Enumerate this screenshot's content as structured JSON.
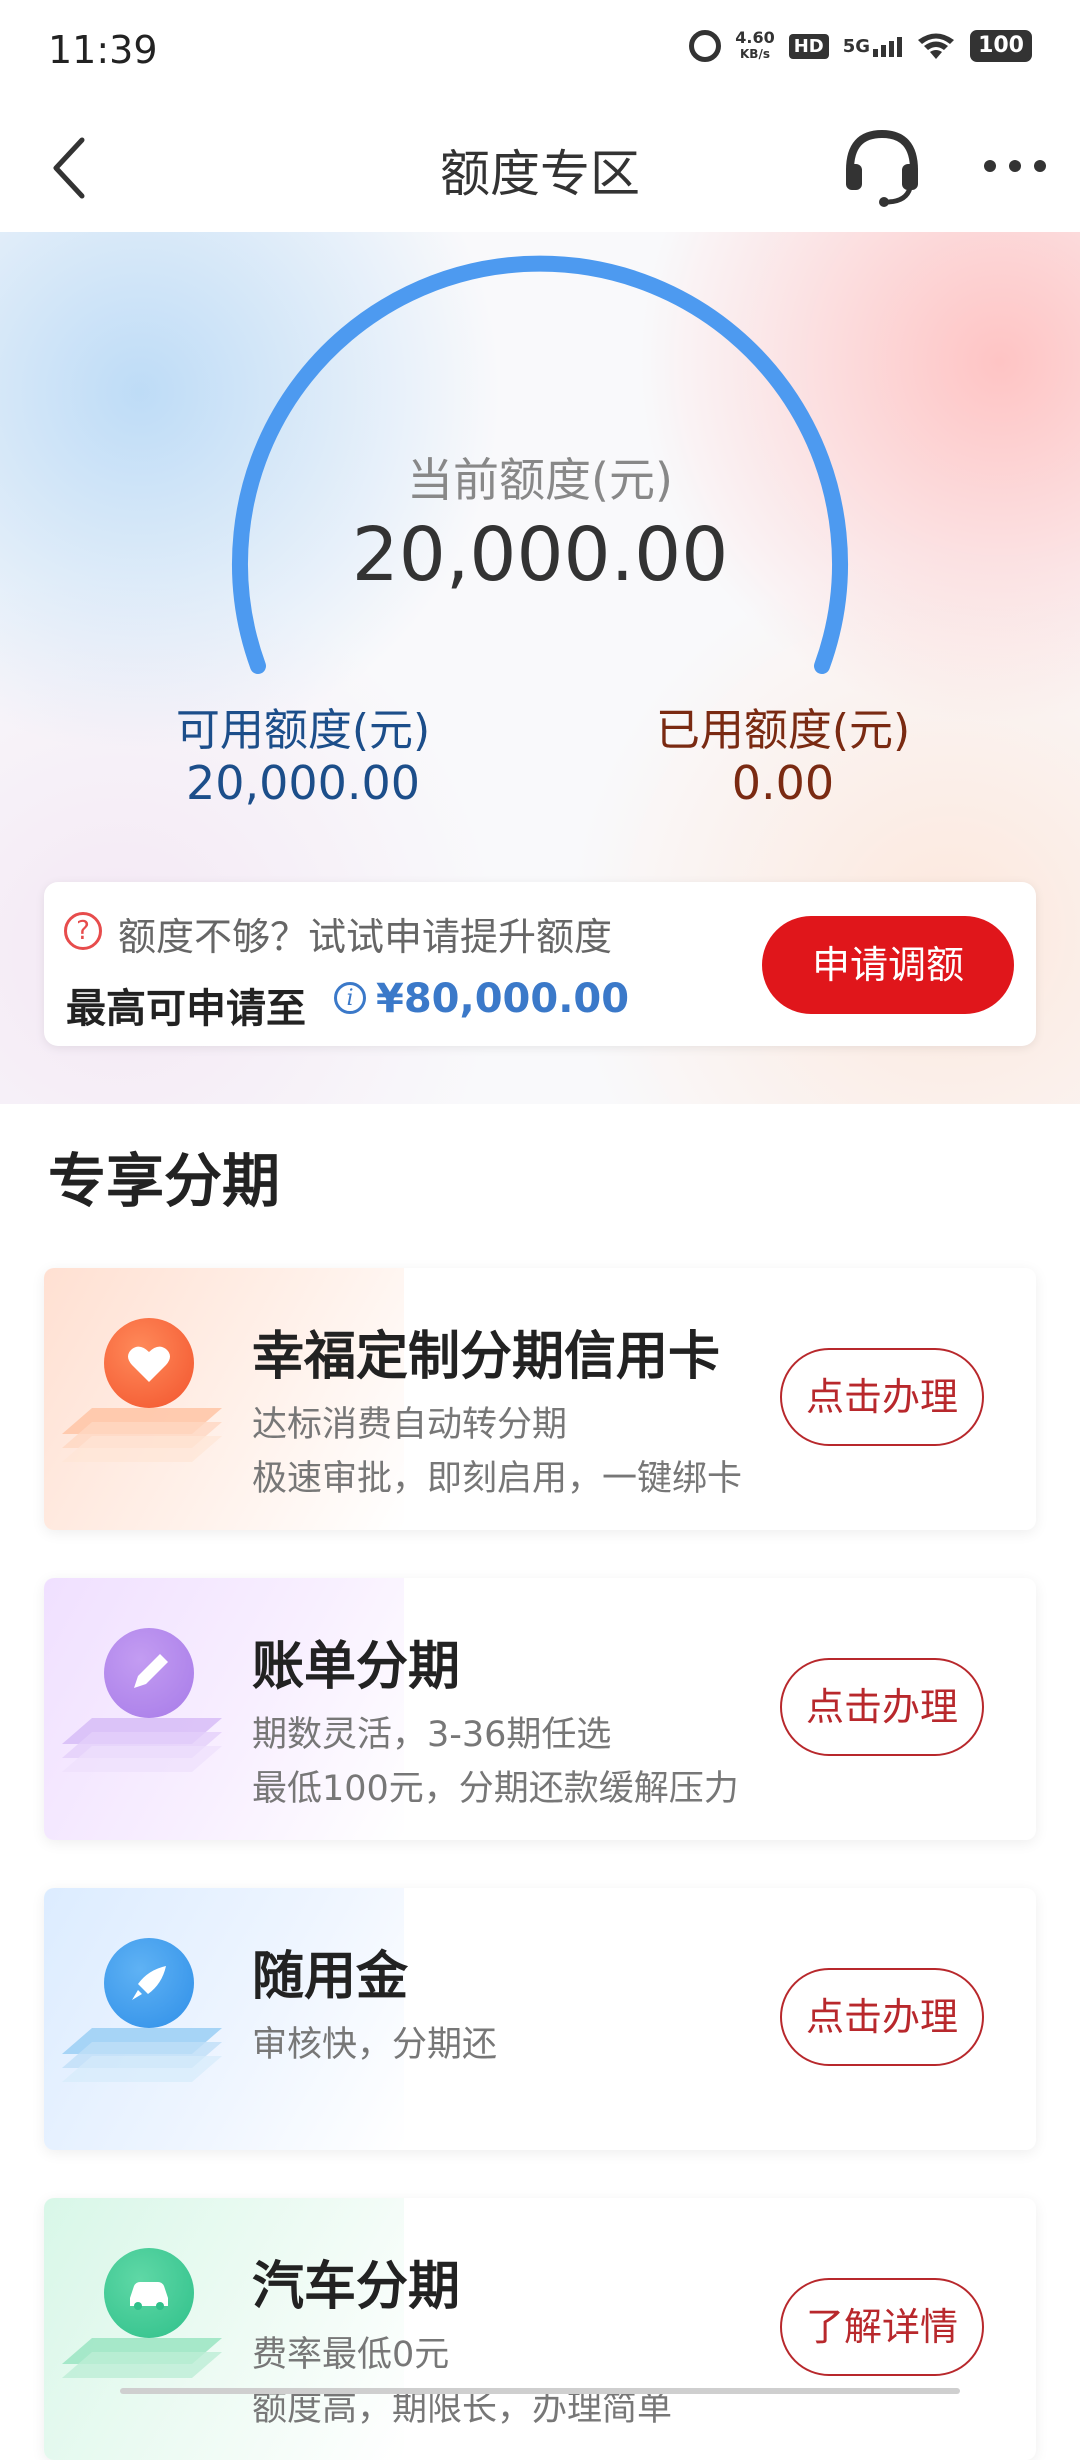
{
  "status_bar": {
    "time": "11:39",
    "speed": "4.60",
    "speed_unit": "KB/s",
    "hd": "HD",
    "network": "5G",
    "battery": "100"
  },
  "nav": {
    "title": "额度专区",
    "icons": [
      "back-icon",
      "headset-icon",
      "more-icon"
    ]
  },
  "quota": {
    "current_label": "当前额度(元)",
    "current_value": "20,000.00",
    "available_label": "可用额度(元)",
    "available_value": "20,000.00",
    "used_label": "已用额度(元)",
    "used_value": "0.00",
    "gauge_color": "#4d9af0"
  },
  "boost": {
    "hint": "额度不够？试试申请提升额度",
    "max_label": "最高可申请至",
    "max_value": "¥80,000.00",
    "apply_label": "申请调额",
    "accent": "#e0161b"
  },
  "section": {
    "title": "专享分期"
  },
  "cards": [
    {
      "title": "幸福定制分期信用卡",
      "desc1": "达标消费自动转分期",
      "desc2": "极速审批，即刻启用，一键绑卡",
      "button": "点击办理",
      "icon": "heart-icon",
      "color": "#f2542d"
    },
    {
      "title": "账单分期",
      "desc1": "期数灵活，3-36期任选",
      "desc2": "最低100元，分期还款缓解压力",
      "button": "点击办理",
      "icon": "pencil-icon",
      "color": "#a77be8"
    },
    {
      "title": "随用金",
      "desc1": "审核快，分期还",
      "desc2": "",
      "button": "点击办理",
      "icon": "rocket-icon",
      "color": "#2f8fe8"
    },
    {
      "title": "汽车分期",
      "desc1": "费率最低0元",
      "desc2": "额度高，期限长，办理简单",
      "button": "了解详情",
      "icon": "car-icon",
      "color": "#2fc08a"
    }
  ]
}
